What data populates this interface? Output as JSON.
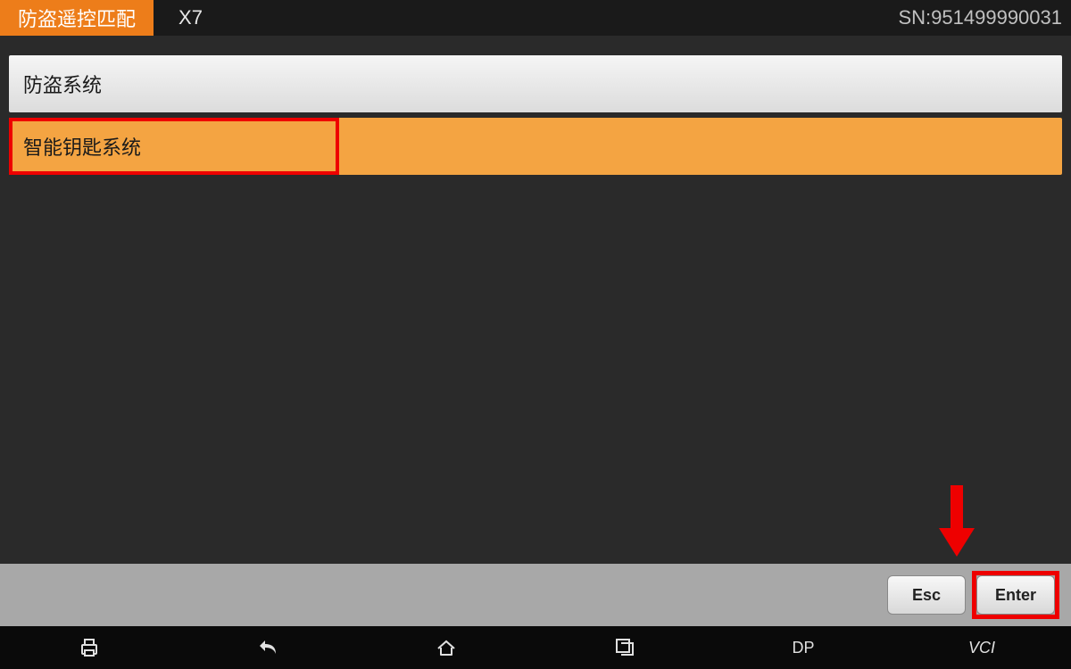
{
  "header": {
    "title": "防盗遥控匹配",
    "model": "X7",
    "sn": "SN:951499990031"
  },
  "list": {
    "items": [
      {
        "label": "防盗系统"
      },
      {
        "label": "智能钥匙系统"
      }
    ]
  },
  "footer": {
    "esc_label": "Esc",
    "enter_label": "Enter"
  },
  "navbar": {
    "dp_label": "DP",
    "vci_label": "VCI"
  }
}
